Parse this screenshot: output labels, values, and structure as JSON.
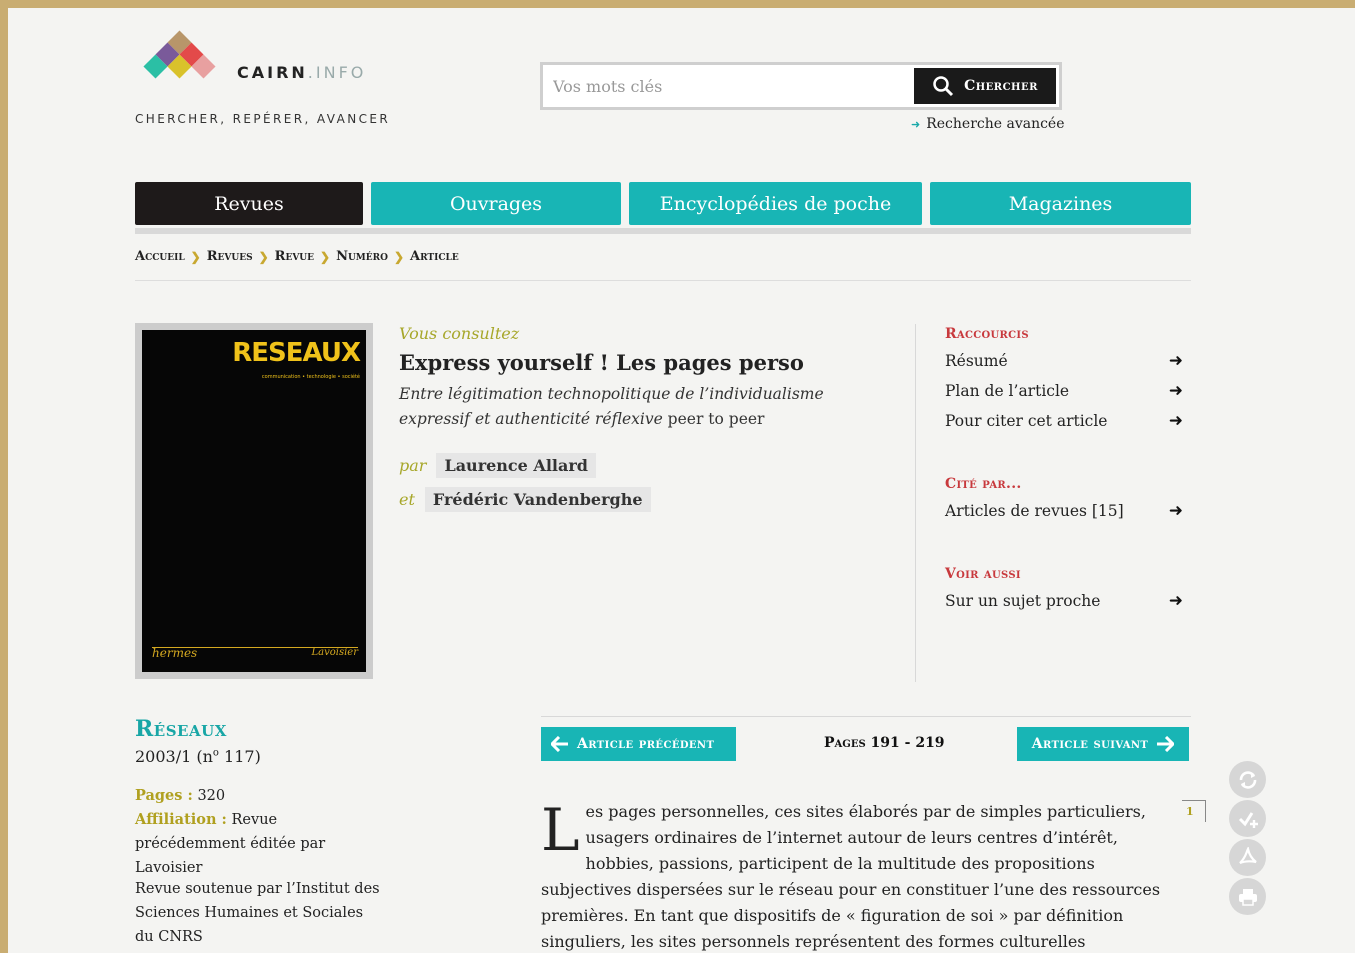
{
  "header": {
    "logo_word": "CAIRN",
    "logo_suffix": ".INFO",
    "tagline": "CHERCHER, REPÉRER, AVANCER",
    "search": {
      "placeholder": "Vos mots clés",
      "button_label": "Chercher"
    },
    "advanced_search": "Recherche avancée"
  },
  "nav": {
    "tabs": [
      {
        "label": "Revues",
        "active": true
      },
      {
        "label": "Ouvrages",
        "active": false
      },
      {
        "label": "Encyclopédies de poche",
        "active": false
      },
      {
        "label": "Magazines",
        "active": false
      }
    ]
  },
  "breadcrumb": [
    "Accueil",
    "Revues",
    "Revue",
    "Numéro",
    "Article"
  ],
  "cover": {
    "title": "RESEAUX",
    "subtitle": "communication • technologie • société",
    "publisher_left": "hermes",
    "publisher_right": "Lavoisier"
  },
  "article": {
    "consult_label": "Vous consultez",
    "title": "Express yourself ! Les pages perso",
    "subtitle_italic": "Entre légitimation technopolitique de l’individualisme expressif et authenticité réflexive",
    "subtitle_plain": " peer to peer",
    "authors": [
      {
        "prefix": "par",
        "name": "Laurence Allard"
      },
      {
        "prefix": "et",
        "name": "Frédéric Vandenberghe"
      }
    ]
  },
  "shortcuts": {
    "sections": [
      {
        "heading": "Raccourcis",
        "items": [
          "Résumé",
          "Plan de l’article",
          "Pour citer cet article"
        ]
      },
      {
        "heading": "Cité par...",
        "items": [
          "Articles de revues [15]"
        ]
      },
      {
        "heading": "Voir aussi",
        "items": [
          "Sur un sujet proche"
        ]
      }
    ]
  },
  "journal": {
    "title": "Réseaux",
    "issue_prefix": "2003/1 (n",
    "issue_sup": "o",
    "issue_suffix": " 117)",
    "pages_label": "Pages :",
    "pages_value": " 320",
    "affiliation_label": "Affiliation :",
    "affiliation_value": " Revue précédemment éditée par Lavoisier",
    "support": "Revue soutenue par l’Institut des Sciences Humaines et Sociales du CNRS"
  },
  "article_nav": {
    "prev_label": "Article précédent",
    "next_label": "Article suivant",
    "pages": "Pages 191 - 219"
  },
  "body": {
    "dropcap": "L",
    "text": "es pages personnelles, ces sites élaborés par de simples particuliers, usagers ordinaires de l’internet autour de leurs centres d’intérêt, hobbies, passions, participent de la multitude des propositions subjectives dispersées sur le réseau pour en constituer l’une des ressources premières. En tant que dispositifs de « figuration de soi » par définition singuliers, les sites personnels représentent des formes culturelles autocentrées, délimitant ce que nous",
    "paragraph_number": "1"
  },
  "tools": [
    "refresh-icon",
    "check-add-icon",
    "pdf-icon",
    "print-icon"
  ],
  "colors": {
    "teal": "#18b5b5",
    "dark": "#1e1a1a",
    "olive": "#a7a72a",
    "red": "#c8393d",
    "frame": "#c9ad72"
  }
}
